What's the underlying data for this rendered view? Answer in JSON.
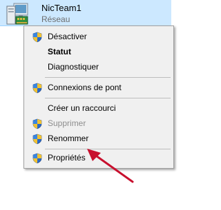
{
  "network_item": {
    "name": "NicTeam1",
    "subtitle": "Réseau",
    "icon": "network-adapter-icon"
  },
  "context_menu": {
    "items": [
      {
        "label": "Désactiver",
        "icon": "uac-shield-icon",
        "bold": false,
        "disabled": false
      },
      {
        "label": "Statut",
        "icon": "",
        "bold": true,
        "disabled": false
      },
      {
        "label": "Diagnostiquer",
        "icon": "",
        "bold": false,
        "disabled": false
      },
      {
        "label": "Connexions de pont",
        "icon": "uac-shield-icon",
        "bold": false,
        "disabled": false
      },
      {
        "label": "Créer un raccourci",
        "icon": "",
        "bold": false,
        "disabled": false
      },
      {
        "label": "Supprimer",
        "icon": "uac-shield-icon",
        "bold": false,
        "disabled": true
      },
      {
        "label": "Renommer",
        "icon": "uac-shield-icon",
        "bold": false,
        "disabled": false
      },
      {
        "label": "Propriétés",
        "icon": "uac-shield-icon",
        "bold": false,
        "disabled": false
      }
    ]
  },
  "annotation": {
    "arrow_color": "#e02020",
    "arrow_icon": "red-arrow-icon",
    "points_to": "Propriétés"
  },
  "colors": {
    "selection_bg": "#cce8ff",
    "menu_bg": "#f0f0f0"
  }
}
